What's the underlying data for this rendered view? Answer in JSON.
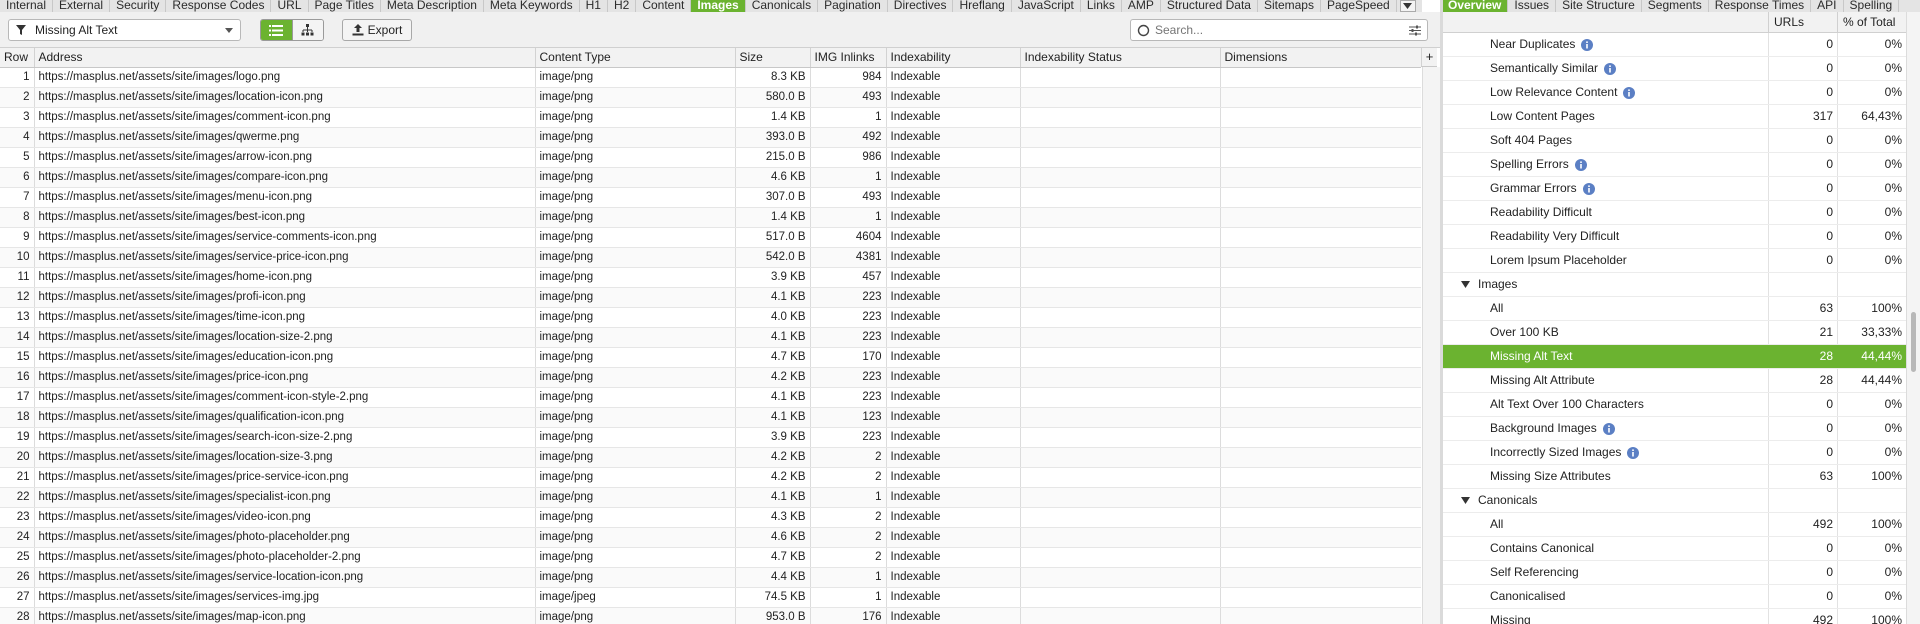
{
  "tabs_left": [
    "Internal",
    "External",
    "Security",
    "Response Codes",
    "URL",
    "Page Titles",
    "Meta Description",
    "Meta Keywords",
    "H1",
    "H2",
    "Content",
    "Images",
    "Canonicals",
    "Pagination",
    "Directives",
    "Hreflang",
    "JavaScript",
    "Links",
    "AMP",
    "Structured Data",
    "Sitemaps",
    "PageSpeed"
  ],
  "tabs_left_active": "Images",
  "tabs_right": [
    "Overview",
    "Issues",
    "Site Structure",
    "Segments",
    "Response Times",
    "API",
    "Spelling"
  ],
  "tabs_right_active": "Overview",
  "toolbar": {
    "filter_value": "Missing Alt Text",
    "export_label": "Export",
    "search_placeholder": "Search..."
  },
  "table": {
    "columns": [
      "Row",
      "Address",
      "Content Type",
      "Size",
      "IMG Inlinks",
      "Indexability",
      "Indexability Status",
      "Dimensions"
    ],
    "rows": [
      [
        "1",
        "https://masplus.net/assets/site/images/logo.png",
        "image/png",
        "8.3 KB",
        "984",
        "Indexable",
        "",
        ""
      ],
      [
        "2",
        "https://masplus.net/assets/site/images/location-icon.png",
        "image/png",
        "580.0 B",
        "493",
        "Indexable",
        "",
        ""
      ],
      [
        "3",
        "https://masplus.net/assets/site/images/comment-icon.png",
        "image/png",
        "1.4 KB",
        "1",
        "Indexable",
        "",
        ""
      ],
      [
        "4",
        "https://masplus.net/assets/site/images/qwerme.png",
        "image/png",
        "393.0 B",
        "492",
        "Indexable",
        "",
        ""
      ],
      [
        "5",
        "https://masplus.net/assets/site/images/arrow-icon.png",
        "image/png",
        "215.0 B",
        "986",
        "Indexable",
        "",
        ""
      ],
      [
        "6",
        "https://masplus.net/assets/site/images/compare-icon.png",
        "image/png",
        "4.6 KB",
        "1",
        "Indexable",
        "",
        ""
      ],
      [
        "7",
        "https://masplus.net/assets/site/images/menu-icon.png",
        "image/png",
        "307.0 B",
        "493",
        "Indexable",
        "",
        ""
      ],
      [
        "8",
        "https://masplus.net/assets/site/images/best-icon.png",
        "image/png",
        "1.4 KB",
        "1",
        "Indexable",
        "",
        ""
      ],
      [
        "9",
        "https://masplus.net/assets/site/images/service-comments-icon.png",
        "image/png",
        "517.0 B",
        "4604",
        "Indexable",
        "",
        ""
      ],
      [
        "10",
        "https://masplus.net/assets/site/images/service-price-icon.png",
        "image/png",
        "542.0 B",
        "4381",
        "Indexable",
        "",
        ""
      ],
      [
        "11",
        "https://masplus.net/assets/site/images/home-icon.png",
        "image/png",
        "3.9 KB",
        "457",
        "Indexable",
        "",
        ""
      ],
      [
        "12",
        "https://masplus.net/assets/site/images/profi-icon.png",
        "image/png",
        "4.1 KB",
        "223",
        "Indexable",
        "",
        ""
      ],
      [
        "13",
        "https://masplus.net/assets/site/images/time-icon.png",
        "image/png",
        "4.0 KB",
        "223",
        "Indexable",
        "",
        ""
      ],
      [
        "14",
        "https://masplus.net/assets/site/images/location-size-2.png",
        "image/png",
        "4.1 KB",
        "223",
        "Indexable",
        "",
        ""
      ],
      [
        "15",
        "https://masplus.net/assets/site/images/education-icon.png",
        "image/png",
        "4.7 KB",
        "170",
        "Indexable",
        "",
        ""
      ],
      [
        "16",
        "https://masplus.net/assets/site/images/price-icon.png",
        "image/png",
        "4.2 KB",
        "223",
        "Indexable",
        "",
        ""
      ],
      [
        "17",
        "https://masplus.net/assets/site/images/comment-icon-style-2.png",
        "image/png",
        "4.1 KB",
        "223",
        "Indexable",
        "",
        ""
      ],
      [
        "18",
        "https://masplus.net/assets/site/images/qualification-icon.png",
        "image/png",
        "4.1 KB",
        "123",
        "Indexable",
        "",
        ""
      ],
      [
        "19",
        "https://masplus.net/assets/site/images/search-icon-size-2.png",
        "image/png",
        "3.9 KB",
        "223",
        "Indexable",
        "",
        ""
      ],
      [
        "20",
        "https://masplus.net/assets/site/images/location-size-3.png",
        "image/png",
        "4.2 KB",
        "2",
        "Indexable",
        "",
        ""
      ],
      [
        "21",
        "https://masplus.net/assets/site/images/price-service-icon.png",
        "image/png",
        "4.2 KB",
        "2",
        "Indexable",
        "",
        ""
      ],
      [
        "22",
        "https://masplus.net/assets/site/images/specialist-icon.png",
        "image/png",
        "4.1 KB",
        "1",
        "Indexable",
        "",
        ""
      ],
      [
        "23",
        "https://masplus.net/assets/site/images/video-icon.png",
        "image/png",
        "4.3 KB",
        "2",
        "Indexable",
        "",
        ""
      ],
      [
        "24",
        "https://masplus.net/assets/site/images/photo-placeholder.png",
        "image/png",
        "4.6 KB",
        "2",
        "Indexable",
        "",
        ""
      ],
      [
        "25",
        "https://masplus.net/assets/site/images/photo-placeholder-2.png",
        "image/png",
        "4.7 KB",
        "2",
        "Indexable",
        "",
        ""
      ],
      [
        "26",
        "https://masplus.net/assets/site/images/service-location-icon.png",
        "image/png",
        "4.4 KB",
        "1",
        "Indexable",
        "",
        ""
      ],
      [
        "27",
        "https://masplus.net/assets/site/images/services-img.jpg",
        "image/jpeg",
        "74.5 KB",
        "1",
        "Indexable",
        "",
        ""
      ],
      [
        "28",
        "https://masplus.net/assets/site/images/map-icon.png",
        "image/png",
        "953.0 B",
        "176",
        "Indexable",
        "",
        ""
      ]
    ]
  },
  "overview": {
    "columns": [
      "",
      "URLs",
      "% of Total"
    ],
    "rows": [
      {
        "type": "item",
        "label": "Near Duplicates",
        "info": true,
        "urls": "0",
        "pct": "0%"
      },
      {
        "type": "item",
        "label": "Semantically Similar",
        "info": true,
        "urls": "0",
        "pct": "0%"
      },
      {
        "type": "item",
        "label": "Low Relevance Content",
        "info": true,
        "urls": "0",
        "pct": "0%"
      },
      {
        "type": "item",
        "label": "Low Content Pages",
        "info": false,
        "urls": "317",
        "pct": "64,43%"
      },
      {
        "type": "item",
        "label": "Soft 404 Pages",
        "info": false,
        "urls": "0",
        "pct": "0%"
      },
      {
        "type": "item",
        "label": "Spelling Errors",
        "info": true,
        "urls": "0",
        "pct": "0%"
      },
      {
        "type": "item",
        "label": "Grammar Errors",
        "info": true,
        "urls": "0",
        "pct": "0%"
      },
      {
        "type": "item",
        "label": "Readability Difficult",
        "info": false,
        "urls": "0",
        "pct": "0%"
      },
      {
        "type": "item",
        "label": "Readability Very Difficult",
        "info": false,
        "urls": "0",
        "pct": "0%"
      },
      {
        "type": "item",
        "label": "Lorem Ipsum Placeholder",
        "info": false,
        "urls": "0",
        "pct": "0%"
      },
      {
        "type": "section",
        "label": "Images",
        "info": false,
        "urls": "",
        "pct": ""
      },
      {
        "type": "item",
        "label": "All",
        "info": false,
        "urls": "63",
        "pct": "100%"
      },
      {
        "type": "item",
        "label": "Over 100 KB",
        "info": false,
        "urls": "21",
        "pct": "33,33%"
      },
      {
        "type": "item",
        "label": "Missing Alt Text",
        "info": false,
        "urls": "28",
        "pct": "44,44%",
        "selected": true
      },
      {
        "type": "item",
        "label": "Missing Alt Attribute",
        "info": false,
        "urls": "28",
        "pct": "44,44%"
      },
      {
        "type": "item",
        "label": "Alt Text Over 100 Characters",
        "info": false,
        "urls": "0",
        "pct": "0%"
      },
      {
        "type": "item",
        "label": "Background Images",
        "info": true,
        "urls": "0",
        "pct": "0%"
      },
      {
        "type": "item",
        "label": "Incorrectly Sized Images",
        "info": true,
        "urls": "0",
        "pct": "0%"
      },
      {
        "type": "item",
        "label": "Missing Size Attributes",
        "info": false,
        "urls": "63",
        "pct": "100%"
      },
      {
        "type": "section",
        "label": "Canonicals",
        "info": false,
        "urls": "",
        "pct": ""
      },
      {
        "type": "item",
        "label": "All",
        "info": false,
        "urls": "492",
        "pct": "100%"
      },
      {
        "type": "item",
        "label": "Contains Canonical",
        "info": false,
        "urls": "0",
        "pct": "0%"
      },
      {
        "type": "item",
        "label": "Self Referencing",
        "info": false,
        "urls": "0",
        "pct": "0%"
      },
      {
        "type": "item",
        "label": "Canonicalised",
        "info": false,
        "urls": "0",
        "pct": "0%"
      },
      {
        "type": "item",
        "label": "Missing",
        "info": false,
        "urls": "492",
        "pct": "100%"
      }
    ]
  },
  "colors": {
    "accent": "#6bb330",
    "info_icon": "#5b7fc4"
  },
  "icons": {
    "filter": "funnel-icon",
    "list_view": "list-icon",
    "tree_view": "tree-icon",
    "export": "upload-icon",
    "search": "magnifier-icon",
    "search_options": "sliders-icon",
    "info": "info-icon",
    "expand": "triangle-down-icon"
  }
}
